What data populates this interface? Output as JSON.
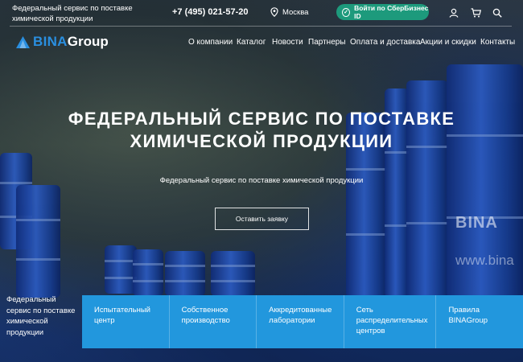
{
  "header": {
    "tagline": "Федеральный сервис по поставке химической продукции",
    "phone": "+7 (495) 021-57-20",
    "city": "Москва",
    "sber_button": "Войти по СберБизнес ID",
    "icons": [
      "location-icon",
      "sber-id-icon",
      "user-icon",
      "cart-icon",
      "search-icon"
    ]
  },
  "logo": {
    "part1": "BINA",
    "part2": "Group"
  },
  "nav": [
    "О компании",
    "Каталог",
    "Новости",
    "Партнеры",
    "Оплата и доставка",
    "Акции и скидки",
    "Контакты"
  ],
  "hero": {
    "title_line1": "ФЕДЕРАЛЬНЫЙ СЕРВИС ПО ПОСТАВКЕ",
    "title_line2": "ХИМИЧЕСКОЙ ПРОДУКЦИИ",
    "subtitle": "Федеральный сервис по поставке химической продукции",
    "cta": "Оставить заявку"
  },
  "background_print": {
    "brand": "BINA",
    "www": "www.bina"
  },
  "bottom": {
    "label": "Федеральный сервис по поставке химической продукции",
    "features": [
      "Испытательный центр",
      "Собственное производство",
      "Аккредитованные лаборатории",
      "Сеть распределительных центров",
      "Правила BINAGroup"
    ]
  },
  "colors": {
    "accent": "#2297dd",
    "sber_green": "#1d9a7c",
    "logo_blue": "#2a8fe0"
  }
}
